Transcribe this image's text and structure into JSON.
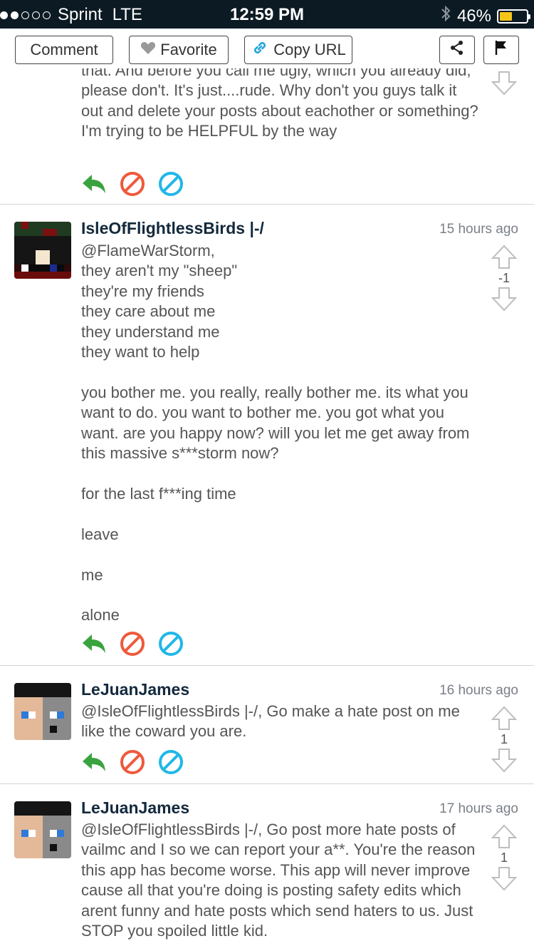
{
  "status_bar": {
    "carrier": "Sprint",
    "network": "LTE",
    "time": "12:59 PM",
    "battery": "46%",
    "battery_level": 0.46
  },
  "toolbar": {
    "comment_label": "Comment",
    "favorite_label": "Favorite",
    "copy_url_label": "Copy URL"
  },
  "comments": [
    {
      "username": "",
      "time": "",
      "body": "that. And before you call me ugly, which you already did, please don't. It's just....rude. Why don't you guys talk it out and delete your posts about eachother or something? I'm trying to be HELPFUL by the way",
      "votes": ""
    },
    {
      "username": "IsleOfFlightlessBirds |-/",
      "time": "15 hours ago",
      "body": "@FlameWarStorm,\nthey aren't my \"sheep\"\nthey're my friends\nthey care about me\nthey understand me\nthey want to help\n\nyou bother me. you really, really bother me. its what you want to do. you want to bother me. you got what you want. are you happy now? will you let me get away from this massive s***storm now?\n\nfor the last f***ing time\n\nleave\n\nme\n\nalone",
      "votes": "-1"
    },
    {
      "username": "LeJuanJames",
      "time": "16 hours ago",
      "body": "@IsleOfFlightlessBirds |-/, Go make a hate post on me like the coward you are.",
      "votes": "1"
    },
    {
      "username": "LeJuanJames",
      "time": "17 hours ago",
      "body": "@IsleOfFlightlessBirds |-/, Go post more hate posts of vailmc and I so we can report your a**. You're the reason this app has become worse. This app will never improve cause all that you're doing is posting safety edits which arent funny and hate posts which send haters to us. Just STOP you spoiled little kid.",
      "votes": "1"
    }
  ],
  "colors": {
    "status_bar_bg": "#0c1a24",
    "reply_green": "#3aa33f",
    "block_red": "#ee5a3c",
    "cancel_blue": "#21b7e8",
    "username": "#13293d"
  },
  "icons": [
    "heart-icon",
    "link-icon",
    "share-icon",
    "flag-icon",
    "reply-icon",
    "block-icon",
    "cancel-icon",
    "upvote-arrow-icon",
    "downvote-arrow-icon",
    "bluetooth-icon",
    "battery-icon"
  ]
}
